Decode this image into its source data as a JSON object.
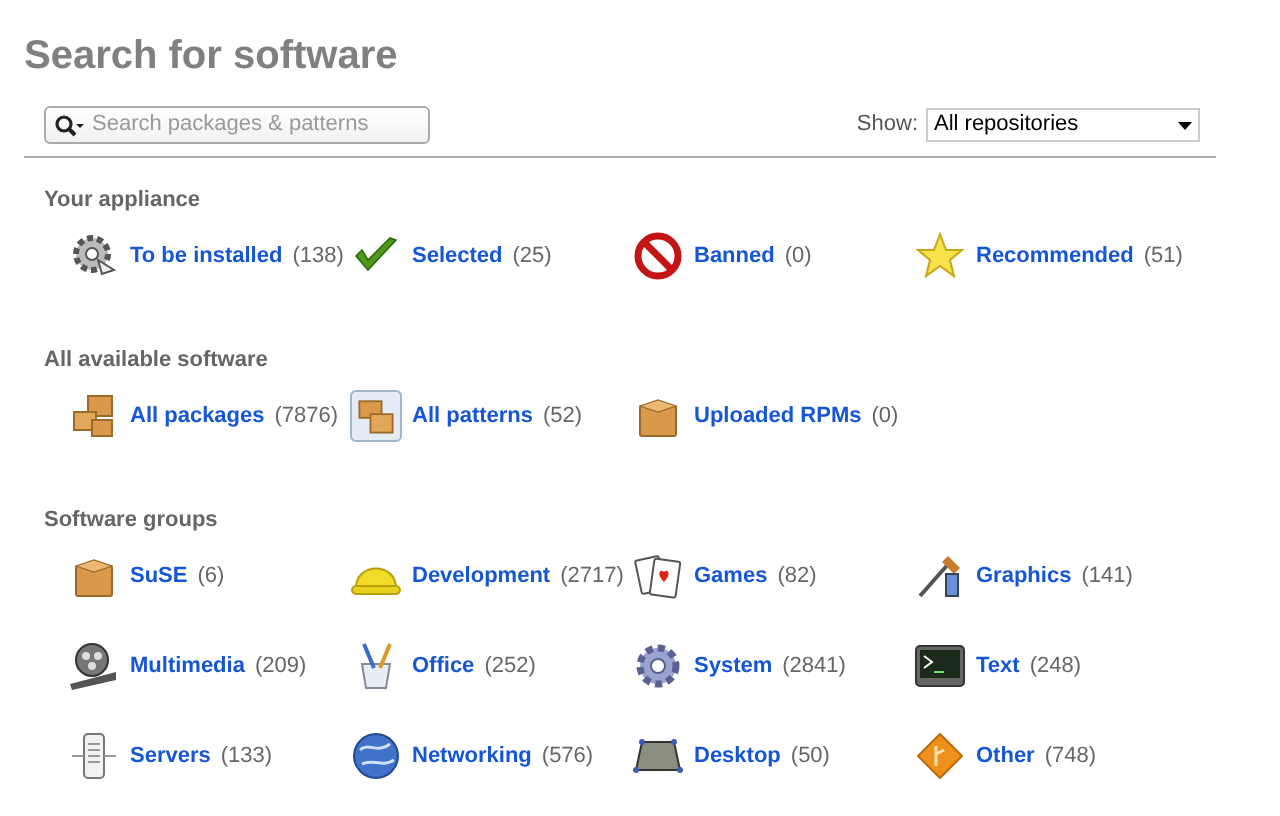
{
  "title": "Search for software",
  "search": {
    "placeholder": "Search packages & patterns"
  },
  "show": {
    "label": "Show:",
    "value": "All repositories"
  },
  "sections": [
    {
      "heading": "Your appliance",
      "items": [
        {
          "label": "To be installed",
          "count": "(138)"
        },
        {
          "label": "Selected",
          "count": "(25)"
        },
        {
          "label": "Banned",
          "count": "(0)"
        },
        {
          "label": "Recommended",
          "count": "(51)"
        }
      ]
    },
    {
      "heading": "All available software",
      "items": [
        {
          "label": "All packages",
          "count": "(7876)",
          "selected": false
        },
        {
          "label": "All patterns",
          "count": "(52)",
          "selected": true
        },
        {
          "label": "Uploaded RPMs",
          "count": "(0)",
          "selected": false
        }
      ]
    },
    {
      "heading": "Software groups",
      "items": [
        {
          "label": "SuSE",
          "count": "(6)"
        },
        {
          "label": "Development",
          "count": "(2717)"
        },
        {
          "label": "Games",
          "count": "(82)"
        },
        {
          "label": "Graphics",
          "count": "(141)"
        },
        {
          "label": "Multimedia",
          "count": "(209)"
        },
        {
          "label": "Office",
          "count": "(252)"
        },
        {
          "label": "System",
          "count": "(2841)"
        },
        {
          "label": "Text",
          "count": "(248)"
        },
        {
          "label": "Servers",
          "count": "(133)"
        },
        {
          "label": "Networking",
          "count": "(576)"
        },
        {
          "label": "Desktop",
          "count": "(50)"
        },
        {
          "label": "Other",
          "count": "(748)"
        }
      ]
    }
  ]
}
